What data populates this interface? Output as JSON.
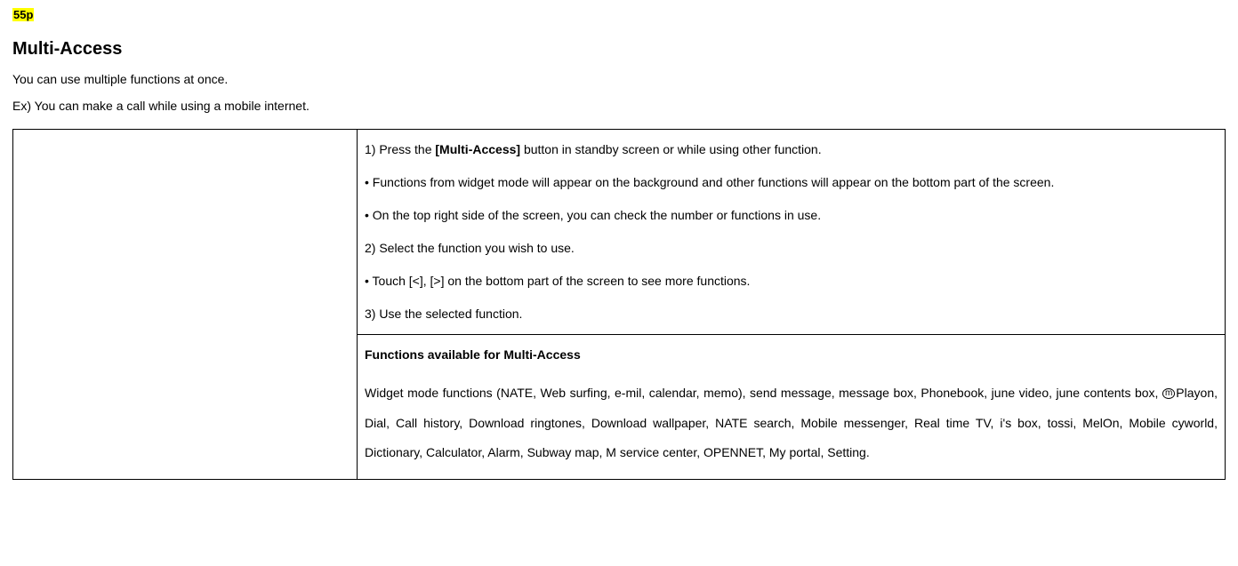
{
  "page_marker": "55p",
  "title": "Multi-Access",
  "intro_1": "You can use multiple functions at once.",
  "intro_2": "Ex) You can make a call while using a mobile internet.",
  "steps": {
    "p1_prefix": "1) Press the ",
    "p1_bold": "[Multi-Access]",
    "p1_suffix": " button in standby screen or while using other function.",
    "p2": "• Functions from widget mode will appear on the background and other functions will appear on the bottom part of the screen.",
    "p3": "• On the top right side of the screen, you can check the number or functions in use.",
    "p4": "2) Select the function you wish to use.",
    "p5": "• Touch [<], [>] on the bottom part of the screen to see more functions.",
    "p6": "3) Use the selected function."
  },
  "functions": {
    "heading": "Functions available for Multi-Access",
    "body_pre": "Widget mode functions (NATE, Web surfing, e-mil, calendar, memo), send message, message box, Phonebook, june video, june contents box, ",
    "circled": "m",
    "body_post": "Playon, Dial, Call history, Download ringtones, Download wallpaper, NATE search, Mobile messenger, Real time TV, i's box, tossi, MelOn, Mobile cyworld, Dictionary, Calculator, Alarm, Subway map, M service center, OPENNET, My portal, Setting."
  }
}
